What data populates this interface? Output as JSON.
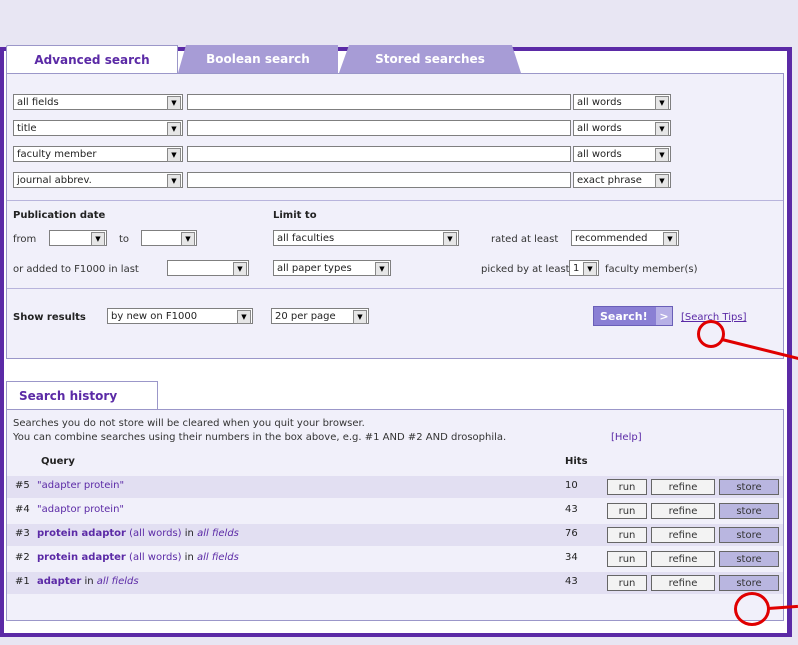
{
  "tabs": [
    {
      "label": "Advanced search"
    },
    {
      "label": "Boolean search"
    },
    {
      "label": "Stored searches"
    }
  ],
  "search_rows": [
    {
      "field": "all fields",
      "mode": "all words"
    },
    {
      "field": "title",
      "mode": "all words"
    },
    {
      "field": "faculty member",
      "mode": "all words"
    },
    {
      "field": "journal abbrev.",
      "mode": "exact phrase"
    }
  ],
  "publication": {
    "title": "Publication date",
    "from_label": "from",
    "to_label": "to",
    "added_label": "or added to F1000 in last"
  },
  "limit": {
    "title": "Limit to",
    "faculties": "all faculties",
    "paper_types": "all paper types",
    "rated_label": "rated at least",
    "rated_value": "recommended",
    "picked_label": "picked by at least",
    "picked_value": "1",
    "picked_suffix": "faculty member(s)"
  },
  "show_results": {
    "label": "Show results",
    "sort": "by new on F1000",
    "per_page": "20 per page"
  },
  "search_button": "Search!",
  "search_arrow": ">",
  "search_tips": "[Search Tips]",
  "history": {
    "tab_label": "Search history",
    "note_line1": "Searches you do not store will be cleared when you quit your browser.",
    "note_line2": "You can combine searches using their numbers in the box above, e.g. #1 AND #2 AND drosophila.",
    "help": "[Help]",
    "col_query": "Query",
    "col_hits": "Hits",
    "run_label": "run",
    "refine_label": "refine",
    "store_label": "store",
    "rows": [
      {
        "num": "#5",
        "q_main": "\"adapter protein\"",
        "q_words": "",
        "q_in": "",
        "q_field": "",
        "hits": "10"
      },
      {
        "num": "#4",
        "q_main": "\"adaptor protein\"",
        "q_words": "",
        "q_in": "",
        "q_field": "",
        "hits": "43"
      },
      {
        "num": "#3",
        "q_main": "protein adaptor",
        "q_words": " (all words)",
        "q_in": " in ",
        "q_field": "all fields",
        "hits": "76"
      },
      {
        "num": "#2",
        "q_main": "protein adapter",
        "q_words": " (all words)",
        "q_in": " in ",
        "q_field": "all fields",
        "hits": "34"
      },
      {
        "num": "#1",
        "q_main": "adapter",
        "q_words": "",
        "q_in": " in ",
        "q_field": "all fields",
        "hits": "43"
      }
    ]
  },
  "colors": {
    "frame": "#5b2aa6",
    "panel": "#f1f0fa",
    "tab_inactive": "#a79cd6",
    "search_button": "#8a7fd4",
    "highlight": "#e00000"
  }
}
